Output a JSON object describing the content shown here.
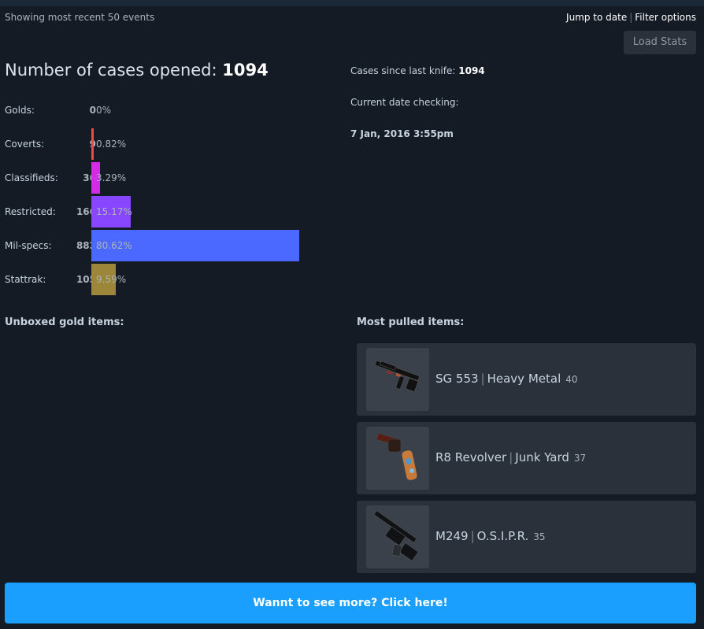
{
  "header": {
    "showing_text": "Showing most recent 50 events",
    "jump_to_date": "Jump to date",
    "separator": "|",
    "filter_options": "Filter options",
    "load_stats": "Load Stats"
  },
  "summary": {
    "cases_label": "Number of cases opened:",
    "cases_value": "1094",
    "since_knife_label": "Cases since last knife:",
    "since_knife_value": "1094",
    "date_checking_label": "Current date checking:",
    "date_value": "7 Jan, 2016 3:55pm"
  },
  "rarity_stats": [
    {
      "label": "Golds:",
      "count": "0",
      "pct": "0%",
      "fraction": 0.0,
      "color": "#e4ae39"
    },
    {
      "label": "Coverts:",
      "count": "9",
      "pct": "0.82%",
      "fraction": 0.0082,
      "color": "#eb4b4b"
    },
    {
      "label": "Classifieds:",
      "count": "36",
      "pct": "3.29%",
      "fraction": 0.0329,
      "color": "#d32ce6"
    },
    {
      "label": "Restricted:",
      "count": "166",
      "pct": "15.17%",
      "fraction": 0.1517,
      "color": "#8847ff"
    },
    {
      "label": "Mil-specs:",
      "count": "882",
      "pct": "80.62%",
      "fraction": 0.8062,
      "color": "#4b69ff"
    },
    {
      "label": "Stattrak:",
      "count": "105",
      "pct": "9.59%",
      "fraction": 0.0959,
      "color": "#9c8639"
    }
  ],
  "sections": {
    "gold_items_title": "Unboxed gold items:",
    "most_pulled_title": "Most pulled items:"
  },
  "most_pulled": [
    {
      "weapon": "SG 553",
      "skin": "Heavy Metal",
      "count": "40",
      "icon": "rifle-icon"
    },
    {
      "weapon": "R8 Revolver",
      "skin": "Junk Yard",
      "count": "37",
      "icon": "revolver-icon"
    },
    {
      "weapon": "M249",
      "skin": "O.S.I.P.R.",
      "count": "35",
      "icon": "machine-gun-icon"
    }
  ],
  "footer": {
    "more_button": "Wannt to see more? Click here!"
  }
}
